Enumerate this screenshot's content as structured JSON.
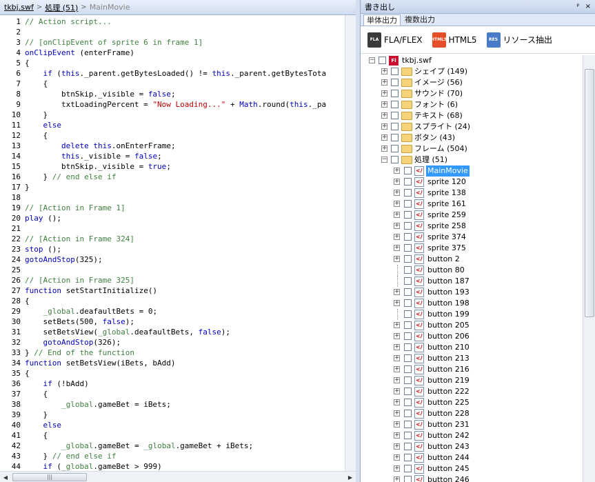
{
  "breadcrumb": {
    "file": "tkbj.swf",
    "folder": "処理 (51)",
    "current": "MainMovie"
  },
  "code_lines": [
    {
      "n": "1",
      "t": "// Action script...",
      "cls": "c"
    },
    {
      "n": "2",
      "t": "",
      "cls": ""
    },
    {
      "n": "3",
      "t": "// [onClipEvent of sprite 6 in frame 1]",
      "cls": "c"
    },
    {
      "n": "4",
      "t": "onClipEvent (enterFrame)",
      "cls": "k1"
    },
    {
      "n": "5",
      "t": "{",
      "cls": ""
    },
    {
      "n": "6",
      "t": "    if (this._parent.getBytesLoaded() != this._parent.getBytesTota",
      "cls": "k1"
    },
    {
      "n": "7",
      "t": "    {",
      "cls": ""
    },
    {
      "n": "8",
      "t": "        btnSkip._visible = false;",
      "cls": "kf"
    },
    {
      "n": "9",
      "t": "        txtLoadingPercent = \"Now Loading...\" + Math.round(this._pa",
      "cls": "ks"
    },
    {
      "n": "10",
      "t": "    }",
      "cls": ""
    },
    {
      "n": "11",
      "t": "    else",
      "cls": "k"
    },
    {
      "n": "12",
      "t": "    {",
      "cls": ""
    },
    {
      "n": "13",
      "t": "        delete this.onEnterFrame;",
      "cls": "k"
    },
    {
      "n": "14",
      "t": "        this._visible = false;",
      "cls": "k"
    },
    {
      "n": "15",
      "t": "        btnSkip._visible = true;",
      "cls": "kf"
    },
    {
      "n": "16",
      "t": "    } // end else if",
      "cls": "ce"
    },
    {
      "n": "17",
      "t": "}",
      "cls": ""
    },
    {
      "n": "18",
      "t": "",
      "cls": ""
    },
    {
      "n": "19",
      "t": "// [Action in Frame 1]",
      "cls": "c"
    },
    {
      "n": "20",
      "t": "play ();",
      "cls": "k1"
    },
    {
      "n": "21",
      "t": "",
      "cls": ""
    },
    {
      "n": "22",
      "t": "// [Action in Frame 324]",
      "cls": "c"
    },
    {
      "n": "23",
      "t": "stop ();",
      "cls": "k1"
    },
    {
      "n": "24",
      "t": "gotoAndStop(325);",
      "cls": "k1"
    },
    {
      "n": "25",
      "t": "",
      "cls": ""
    },
    {
      "n": "26",
      "t": "// [Action in Frame 325]",
      "cls": "c"
    },
    {
      "n": "27",
      "t": "function setStartInitialize()",
      "cls": "k1"
    },
    {
      "n": "28",
      "t": "{",
      "cls": ""
    },
    {
      "n": "29",
      "t": "    _global.deafaultBets = 0;",
      "cls": "g"
    },
    {
      "n": "30",
      "t": "    setBets(500, false);",
      "cls": "kf"
    },
    {
      "n": "31",
      "t": "    setBetsView(_global.deafaultBets, false);",
      "cls": "kf"
    },
    {
      "n": "32",
      "t": "    gotoAndStop(326);",
      "cls": "k1"
    },
    {
      "n": "33",
      "t": "} // End of the function",
      "cls": "ce"
    },
    {
      "n": "34",
      "t": "function setBetsView(iBets, bAdd)",
      "cls": "k1"
    },
    {
      "n": "35",
      "t": "{",
      "cls": ""
    },
    {
      "n": "36",
      "t": "    if (!bAdd)",
      "cls": "k1"
    },
    {
      "n": "37",
      "t": "    {",
      "cls": ""
    },
    {
      "n": "38",
      "t": "        _global.gameBet = iBets;",
      "cls": "g"
    },
    {
      "n": "39",
      "t": "    }",
      "cls": ""
    },
    {
      "n": "40",
      "t": "    else",
      "cls": "k"
    },
    {
      "n": "41",
      "t": "    {",
      "cls": ""
    },
    {
      "n": "42",
      "t": "        _global.gameBet = _global.gameBet + iBets;",
      "cls": "g"
    },
    {
      "n": "43",
      "t": "    } // end else if",
      "cls": "ce"
    },
    {
      "n": "44",
      "t": "    if (_global.gameBet > 999)",
      "cls": "k1"
    }
  ],
  "panel": {
    "title": "書き出し",
    "pin": "ᵖ",
    "close": "×",
    "tabs": [
      "単体出力",
      "複数出力"
    ],
    "buttons": [
      {
        "label": "FLA/FLEX",
        "icon": "FLA"
      },
      {
        "label": "HTML5",
        "icon": "HTML5"
      },
      {
        "label": "リソース抽出",
        "icon": "RES"
      }
    ]
  },
  "tree": {
    "root": "tkbj.swf",
    "folders": [
      "シェイプ (149)",
      "イメージ (56)",
      "サウンド (70)",
      "フォント (6)",
      "テキスト (68)",
      "スプライト (24)",
      "ボタン (43)",
      "フレーム (504)",
      "処理 (51)"
    ],
    "children": [
      "MainMovie",
      "sprite 120",
      "sprite 138",
      "sprite 161",
      "sprite 259",
      "sprite 258",
      "sprite 374",
      "sprite 375",
      "button 2",
      "button 80",
      "button 187",
      "button 193",
      "button 198",
      "button 199",
      "button 205",
      "button 206",
      "button 210",
      "button 213",
      "button 216",
      "button 219",
      "button 222",
      "button 225",
      "button 228",
      "button 231",
      "button 242",
      "button 243",
      "button 244",
      "button 245",
      "button 246"
    ],
    "selected": "MainMovie"
  },
  "colors": {
    "comment": "#3f7f3f",
    "keyword": "#0000c0",
    "string": "#c00000",
    "selection": "#3399ff"
  }
}
